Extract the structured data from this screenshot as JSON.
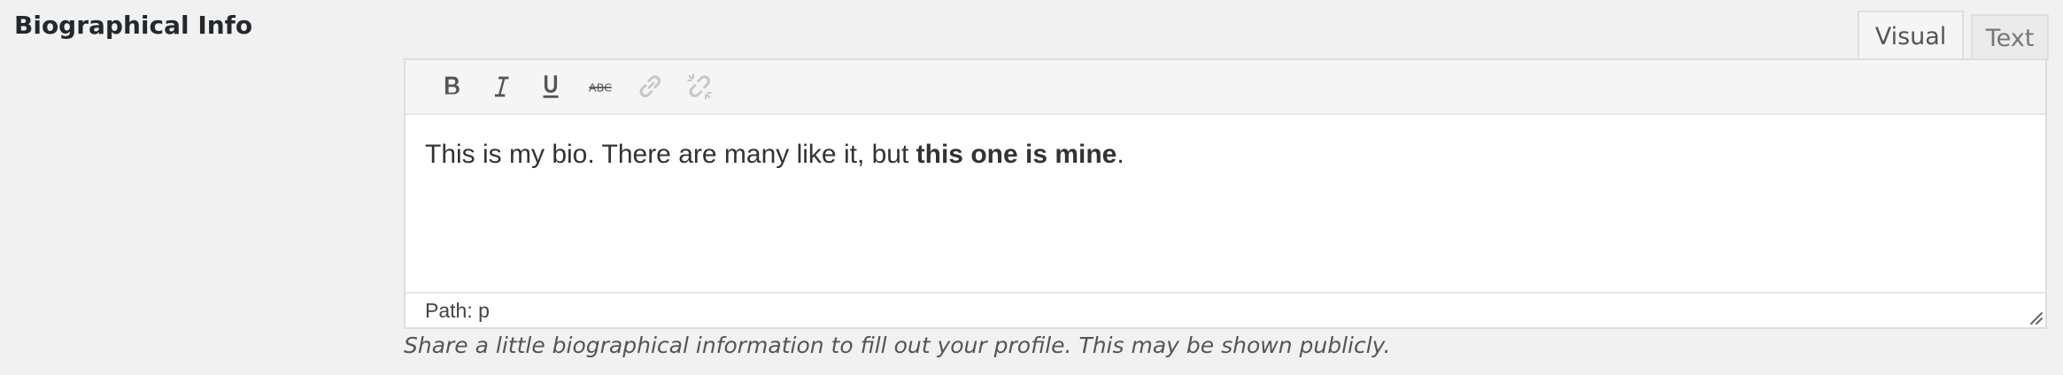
{
  "field": {
    "label": "Biographical Info",
    "description": "Share a little biographical information to fill out your profile. This may be shown publicly."
  },
  "tabs": [
    {
      "label": "Visual",
      "active": true
    },
    {
      "label": "Text",
      "active": false
    }
  ],
  "toolbar": {
    "buttons": [
      {
        "name": "bold-icon",
        "enabled": true
      },
      {
        "name": "italic-icon",
        "enabled": true
      },
      {
        "name": "underline-icon",
        "enabled": true
      },
      {
        "name": "strikethrough-icon",
        "enabled": true
      },
      {
        "name": "link-icon",
        "enabled": false
      },
      {
        "name": "unlink-icon",
        "enabled": false
      }
    ]
  },
  "editor": {
    "content_normal": "This is my bio. There are many like it, but ",
    "content_bold": "this one is mine",
    "content_end": "."
  },
  "statusbar": {
    "path": "Path: p"
  },
  "colors": {
    "background": "#f1f1f1",
    "editor_bg": "#ffffff",
    "toolbar_bg": "#f5f5f5",
    "border": "#dedede",
    "icon_enabled": "#555555",
    "icon_disabled": "#c7c7c7"
  }
}
